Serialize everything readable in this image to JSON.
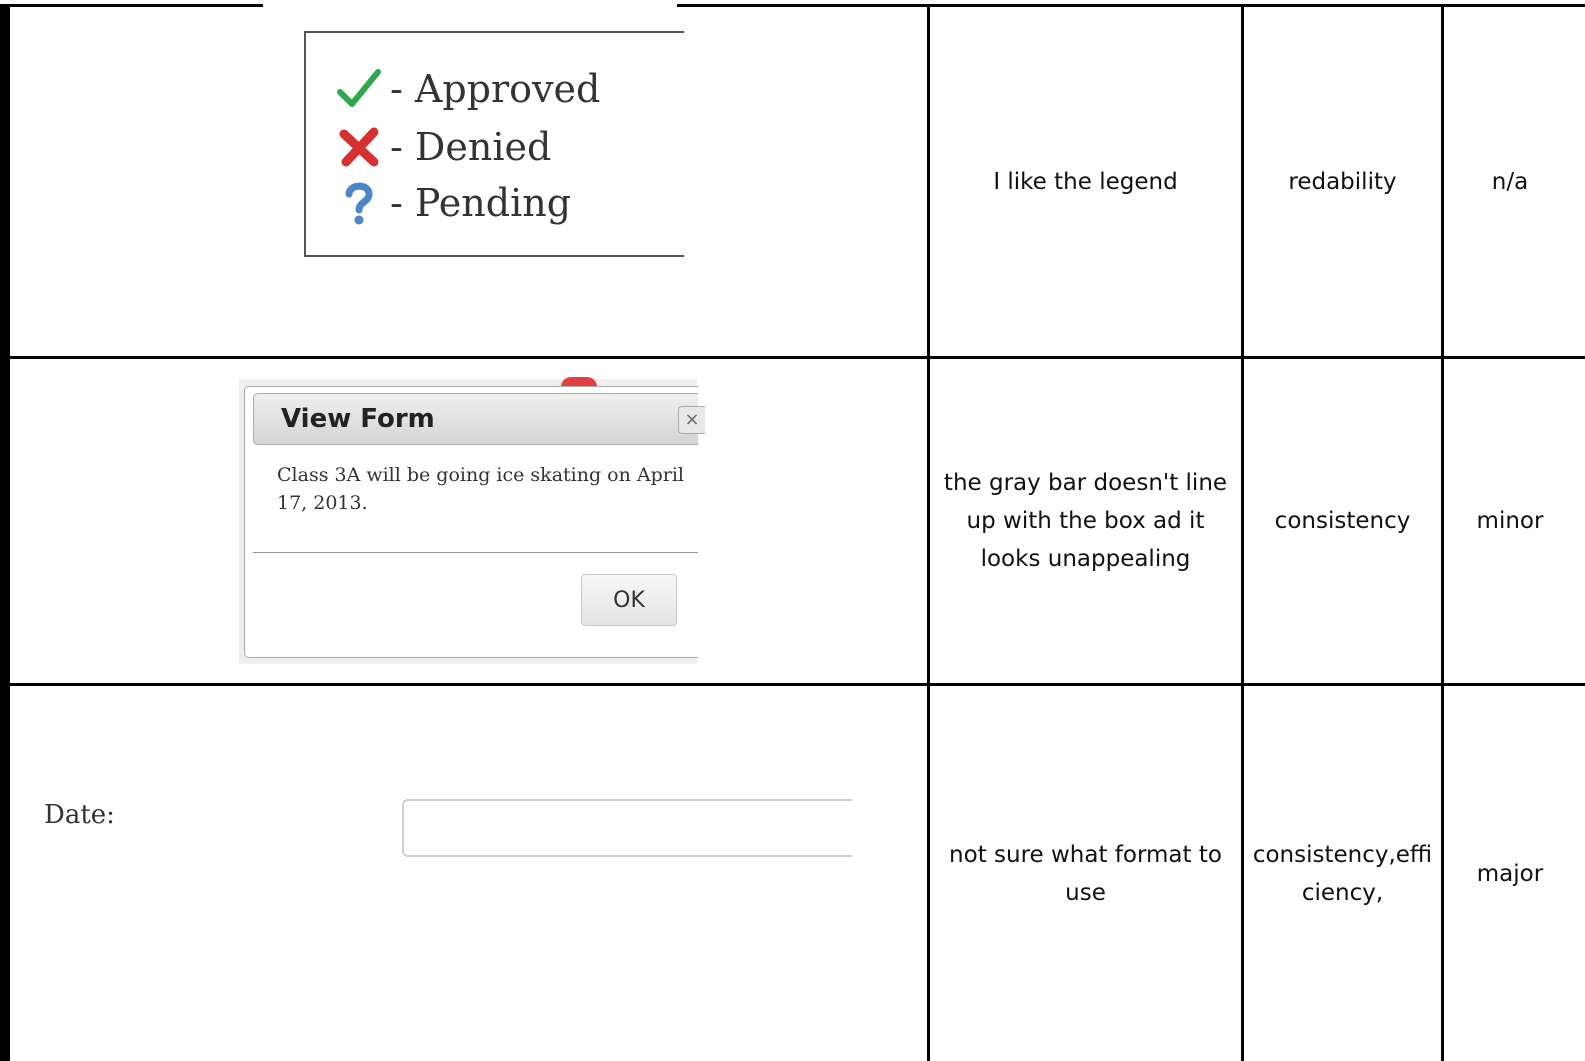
{
  "rows": [
    {
      "screenshot": {
        "legend": [
          {
            "icon": "checkmark-icon",
            "label": "- Approved"
          },
          {
            "icon": "x-mark-icon",
            "label": "- Denied"
          },
          {
            "icon": "question-mark-icon",
            "label": "- Pending"
          }
        ]
      },
      "issue": "I like the legend",
      "heuristic": "redability",
      "severity": "n/a"
    },
    {
      "screenshot": {
        "dialog_title": "View Form",
        "dialog_close": "×",
        "dialog_body": "Class 3A will be going ice skating on April 17, 2013.",
        "ok_label": "OK"
      },
      "issue": "the gray bar doesn't line up with the box ad it looks unappealing",
      "heuristic": "consistency",
      "severity": "minor"
    },
    {
      "screenshot": {
        "field_label": "Date:",
        "field_value": ""
      },
      "issue": "not sure what format to use",
      "heuristic": "consistency,effi ciency,",
      "severity": "major"
    }
  ],
  "colors": {
    "approved": "#2ea84a",
    "denied": "#d63030",
    "pending": "#4a86c8"
  }
}
